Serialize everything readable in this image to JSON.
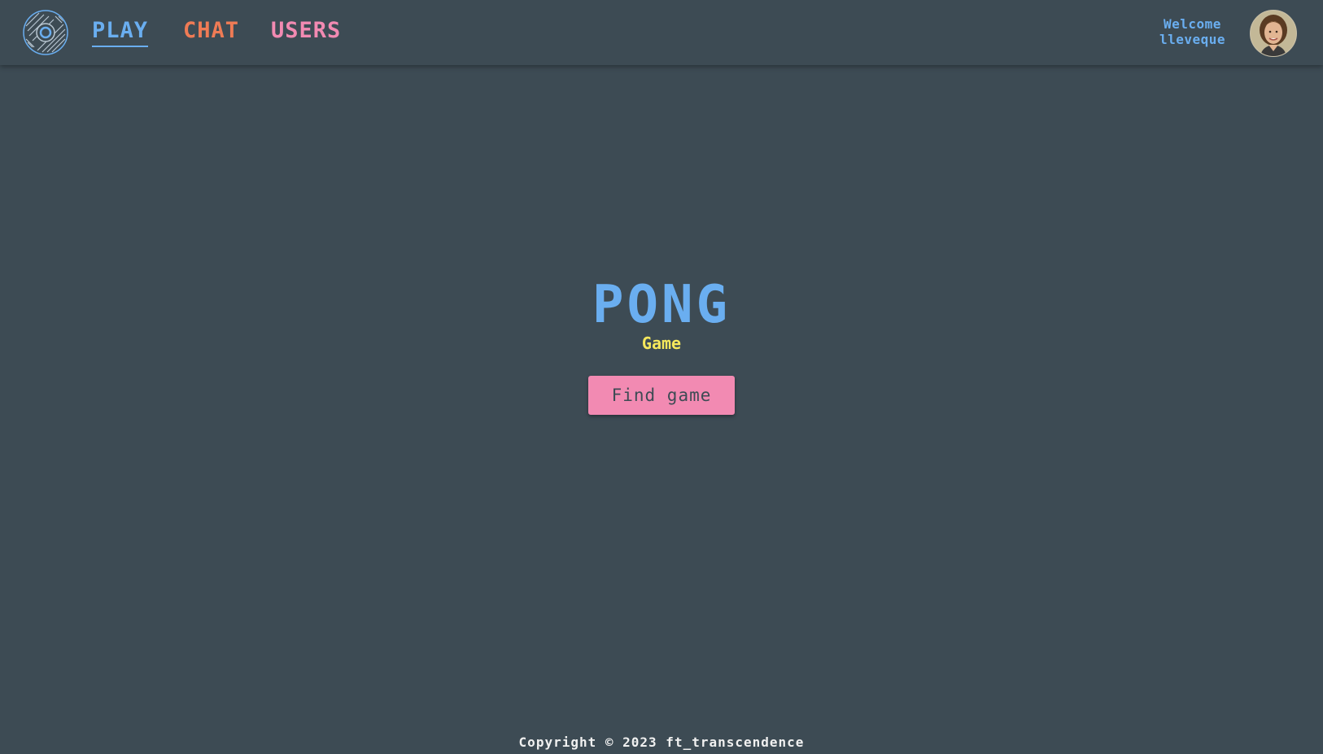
{
  "navbar": {
    "logo_icon": "vinyl-disc-logo",
    "links": [
      {
        "label": "PLAY",
        "color": "#6aaef0",
        "active": true
      },
      {
        "label": "CHAT",
        "color": "#ef7b55",
        "active": false
      },
      {
        "label": "USERS",
        "color": "#f28ab2",
        "active": false
      }
    ],
    "welcome_label": "Welcome",
    "username": "lleveque",
    "avatar_icon": "user-avatar"
  },
  "hero": {
    "title": "PONG",
    "subtitle": "Game",
    "find_button_label": "Find game"
  },
  "footer": {
    "copyright": "Copyright © 2023 ft_transcendence"
  },
  "colors": {
    "background": "#3d4b54",
    "accent_blue": "#6aaef0",
    "accent_yellow": "#f6e85c",
    "accent_pink": "#f28ab2",
    "accent_orange": "#ef7b55"
  }
}
